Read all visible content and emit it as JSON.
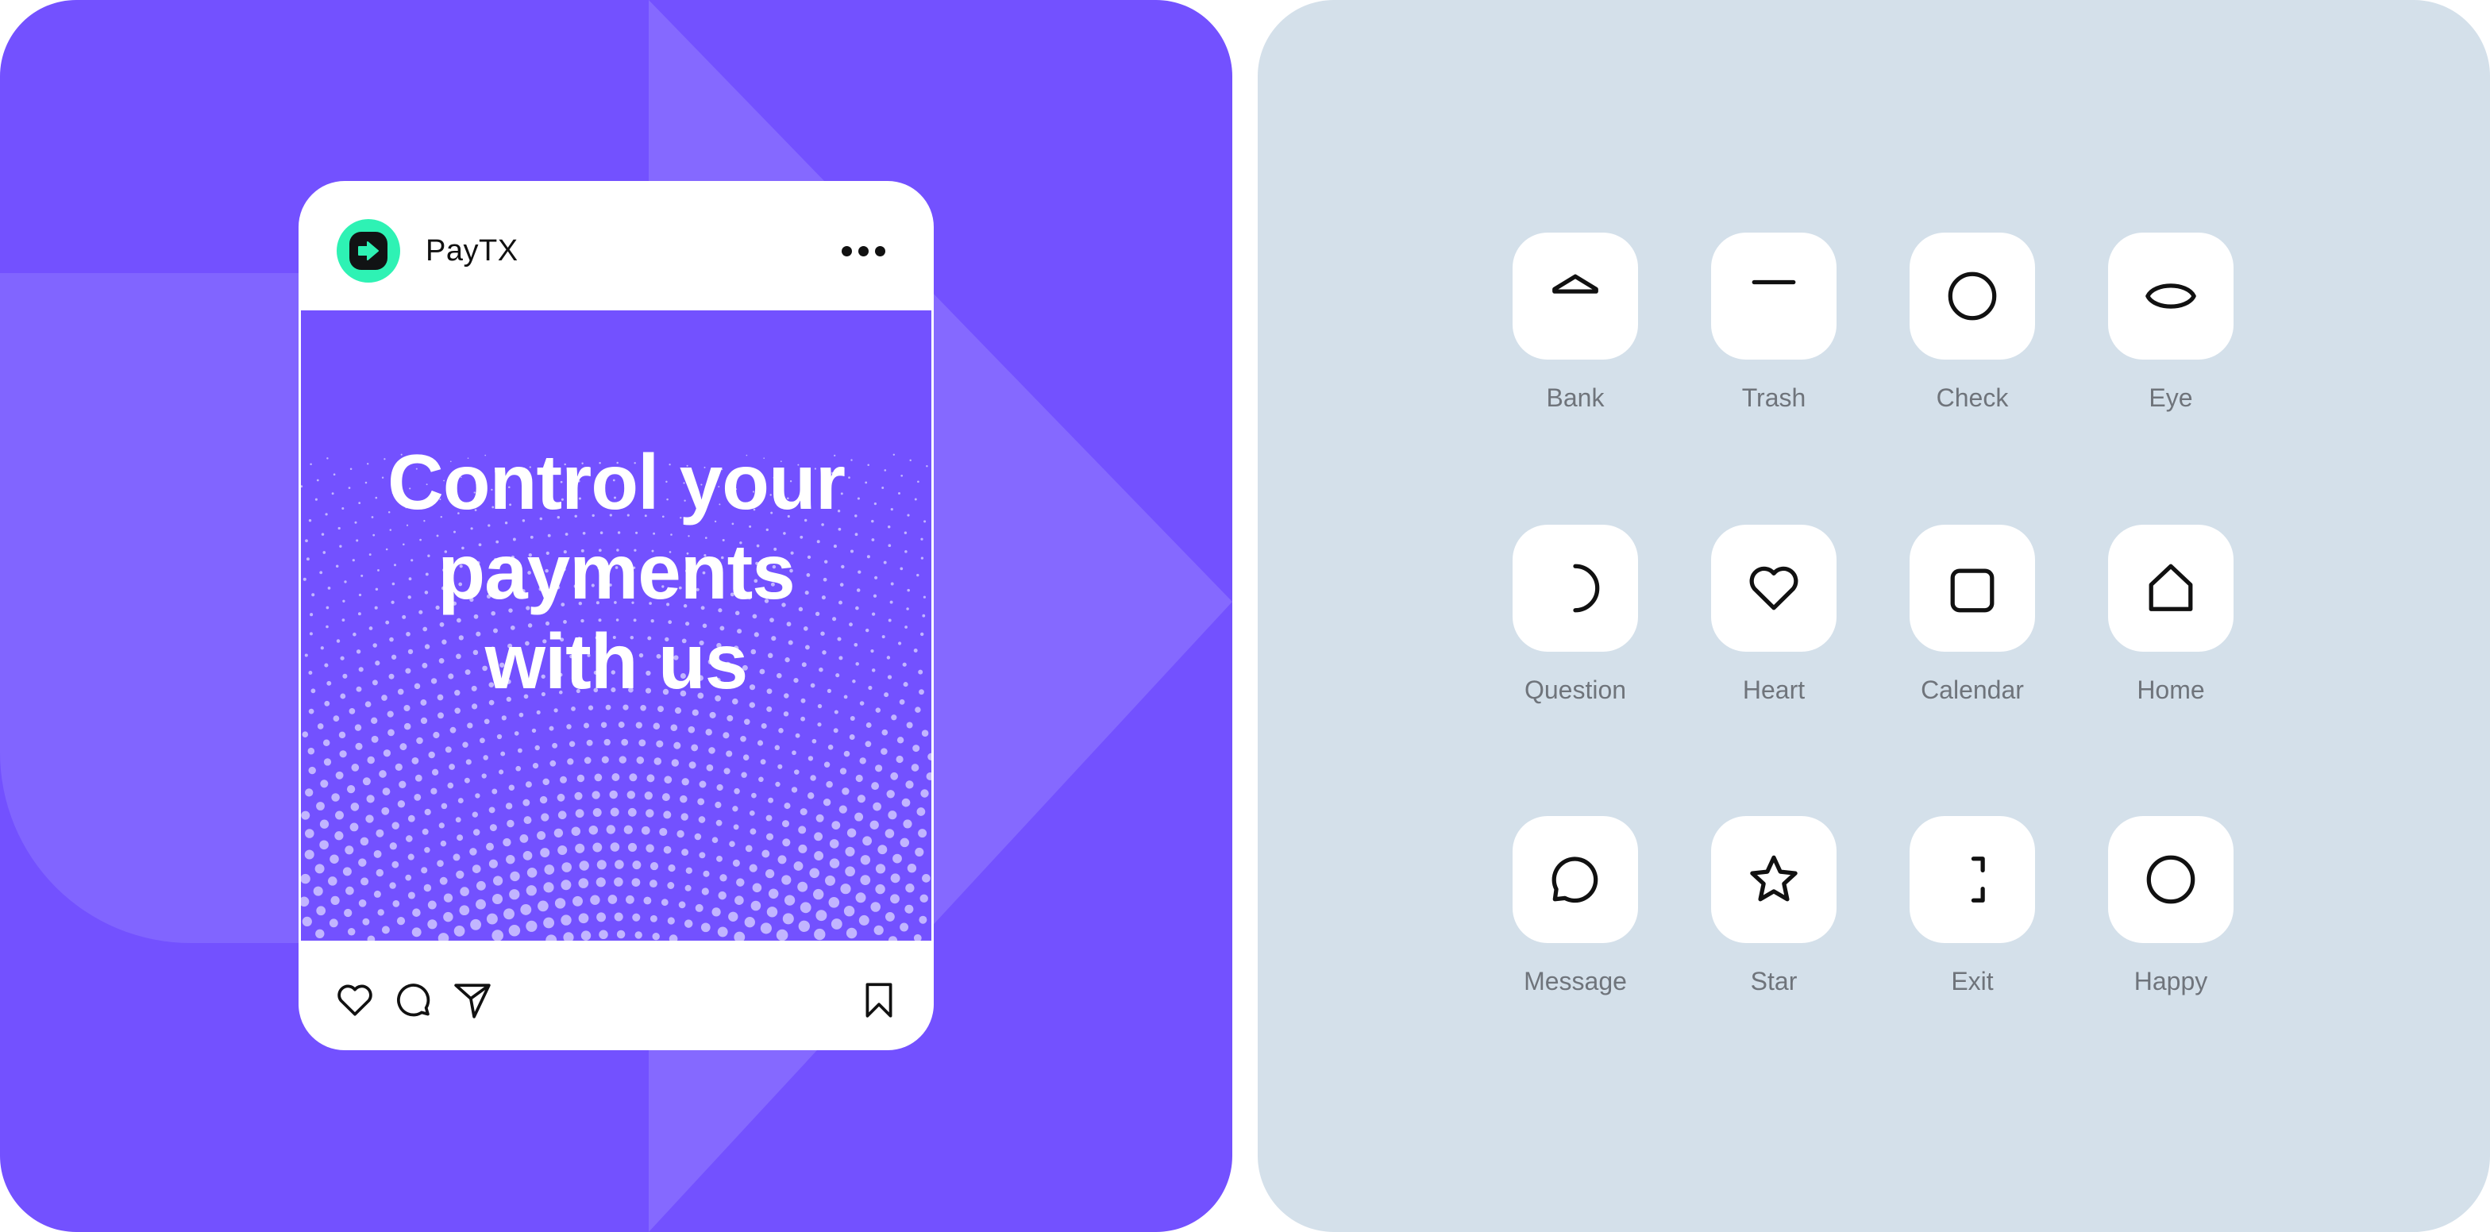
{
  "post": {
    "brand_name": "PayTX",
    "avatar_icon": "arrow-right-icon",
    "menu_icon": "more-horizontal-icon",
    "headline": [
      "Control your",
      "payments",
      "with us"
    ],
    "actions": [
      {
        "name": "like",
        "icon": "heart-icon"
      },
      {
        "name": "comment",
        "icon": "comment-icon"
      },
      {
        "name": "share",
        "icon": "send-icon"
      },
      {
        "name": "save",
        "icon": "bookmark-icon"
      }
    ]
  },
  "icon_grid": {
    "items": [
      {
        "label": "Bank",
        "icon": "bank-icon"
      },
      {
        "label": "Trash",
        "icon": "trash-icon"
      },
      {
        "label": "Check",
        "icon": "check-circle-icon"
      },
      {
        "label": "Eye",
        "icon": "eye-icon"
      },
      {
        "label": "Question",
        "icon": "question-icon"
      },
      {
        "label": "Heart",
        "icon": "heart-icon"
      },
      {
        "label": "Calendar",
        "icon": "calendar-icon"
      },
      {
        "label": "Home",
        "icon": "home-icon"
      },
      {
        "label": "Message",
        "icon": "message-icon"
      },
      {
        "label": "Star",
        "icon": "star-icon"
      },
      {
        "label": "Exit",
        "icon": "exit-icon"
      },
      {
        "label": "Happy",
        "icon": "happy-icon"
      }
    ]
  },
  "colors": {
    "brand_purple": "#7351FF",
    "brand_green": "#2EF2B4",
    "panel_grey": "#D4E0EA",
    "label_grey": "#6F747B",
    "dot_lavender": "#C2B5FF"
  }
}
